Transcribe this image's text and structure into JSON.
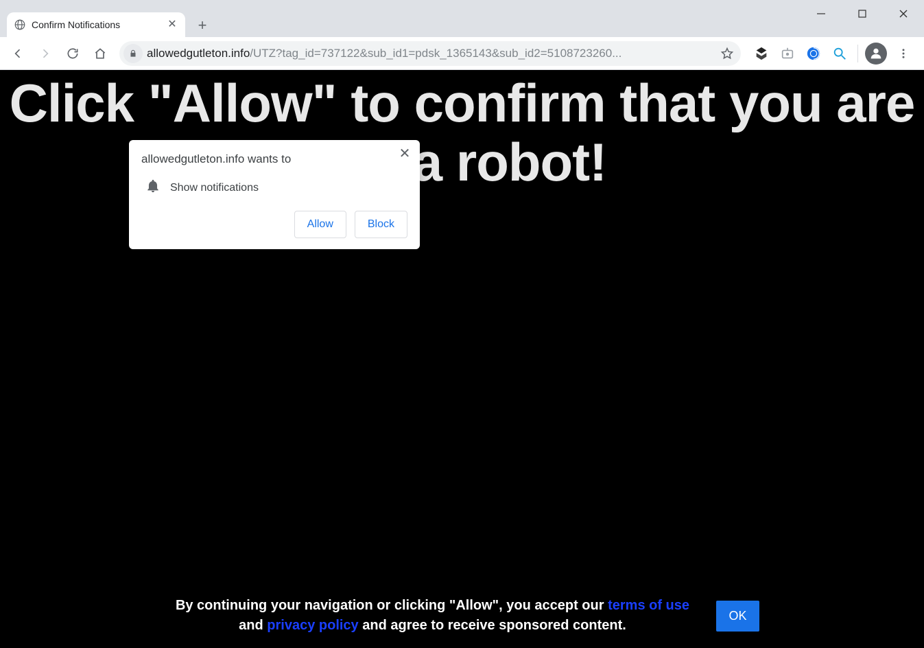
{
  "tab": {
    "title": "Confirm Notifications"
  },
  "url": {
    "host": "allowedgutleton.info",
    "path": "/UTZ?tag_id=737122&sub_id1=pdsk_1365143&sub_id2=5108723260..."
  },
  "page": {
    "headline": "Click \"Allow\" to confirm that you are not a robot!"
  },
  "prompt": {
    "head": "allowedgutleton.info wants to",
    "permission_label": "Show notifications",
    "allow_label": "Allow",
    "block_label": "Block"
  },
  "footer": {
    "prefix": "By continuing your navigation or clicking \"Allow\", you accept our ",
    "terms_label": "terms of use",
    "mid1": " and ",
    "privacy_label": "privacy policy",
    "suffix": " and agree to receive sponsored content.",
    "ok_label": "OK"
  }
}
